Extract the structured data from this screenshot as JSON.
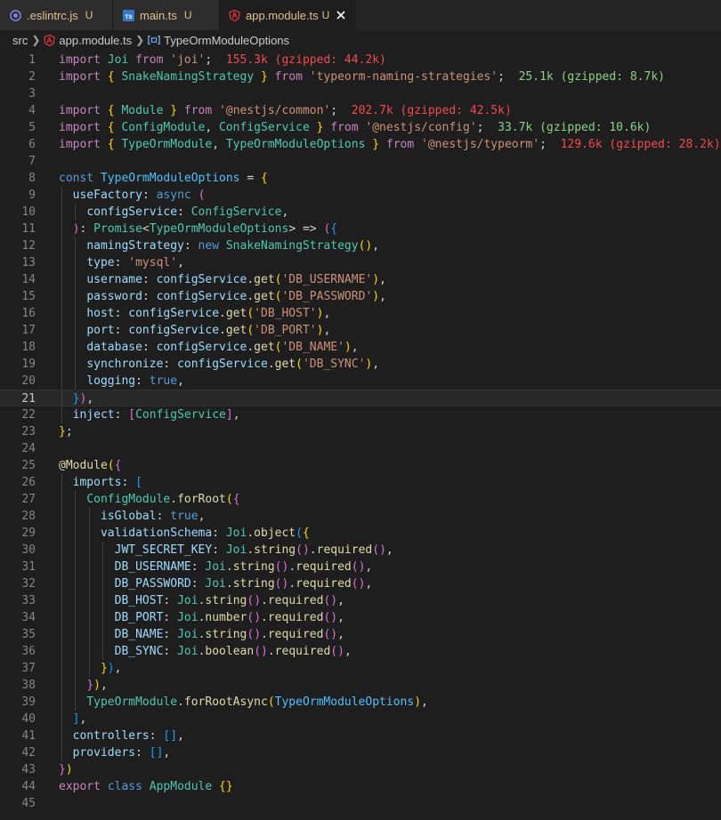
{
  "tabs": [
    {
      "name": ".eslintrc.js",
      "status": "U",
      "icon": "eslint-icon"
    },
    {
      "name": "main.ts",
      "status": "U",
      "icon": "typescript-icon"
    },
    {
      "name": "app.module.ts",
      "status": "U",
      "icon": "angular-icon",
      "active": true
    }
  ],
  "breadcrumb": {
    "folder": "src",
    "file": "app.module.ts",
    "symbol": "TypeOrmModuleOptions"
  },
  "code": {
    "current_line": 21,
    "lines": [
      "import Joi from 'joi';  155.3k (gzipped: 44.2k)",
      "import { SnakeNamingStrategy } from 'typeorm-naming-strategies';  25.1k (gzipped: 8.7k)",
      "",
      "import { Module } from '@nestjs/common';  202.7k (gzipped: 42.5k)",
      "import { ConfigModule, ConfigService } from '@nestjs/config';  33.7k (gzipped: 10.6k)",
      "import { TypeOrmModule, TypeOrmModuleOptions } from '@nestjs/typeorm';  129.6k (gzipped: 28.2k)",
      "",
      "const TypeOrmModuleOptions = {",
      "  useFactory: async (",
      "    configService: ConfigService,",
      "  ): Promise<TypeOrmModuleOptions> => ({",
      "    namingStrategy: new SnakeNamingStrategy(),",
      "    type: 'mysql',",
      "    username: configService.get('DB_USERNAME'),",
      "    password: configService.get('DB_PASSWORD'),",
      "    host: configService.get('DB_HOST'),",
      "    port: configService.get('DB_PORT'),",
      "    database: configService.get('DB_NAME'),",
      "    synchronize: configService.get('DB_SYNC'),",
      "    logging: true,",
      "  }),",
      "  inject: [ConfigService],",
      "};",
      "",
      "@Module({",
      "  imports: [",
      "    ConfigModule.forRoot({",
      "      isGlobal: true,",
      "      validationSchema: Joi.object({",
      "        JWT_SECRET_KEY: Joi.string().required(),",
      "        DB_USERNAME: Joi.string().required(),",
      "        DB_PASSWORD: Joi.string().required(),",
      "        DB_HOST: Joi.string().required(),",
      "        DB_PORT: Joi.number().required(),",
      "        DB_NAME: Joi.string().required(),",
      "        DB_SYNC: Joi.boolean().required(),",
      "      }),",
      "    }),",
      "    TypeOrmModule.forRootAsync(TypeOrmModuleOptions),",
      "  ],",
      "  controllers: [],",
      "  providers: [],",
      "})",
      "export class AppModule {}",
      ""
    ]
  }
}
